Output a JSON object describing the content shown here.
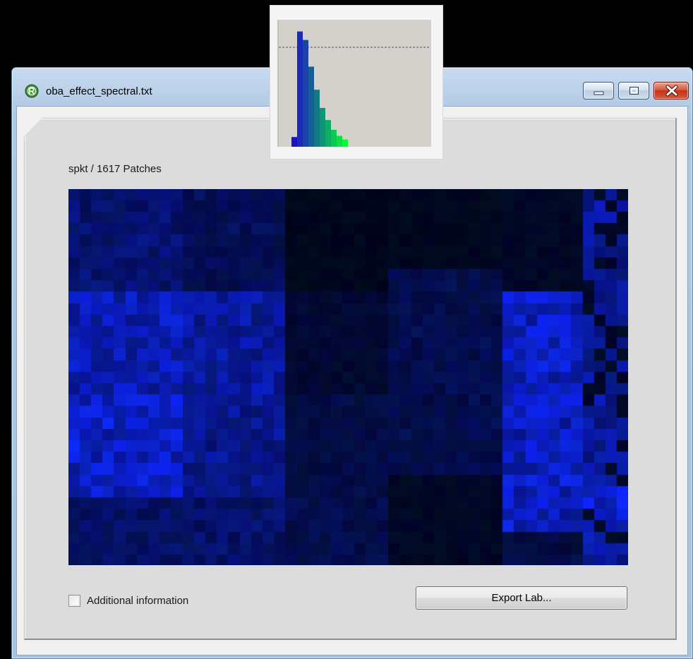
{
  "window": {
    "title": "oba_effect_spectral.txt",
    "controls": {
      "minimize": "minimize",
      "maximize": "maximize",
      "close": "close"
    }
  },
  "panel": {
    "heading": "spkt / 1617 Patches",
    "patch_count": 1617
  },
  "options": {
    "additional_info_label": "Additional information",
    "additional_info_checked": false
  },
  "actions": {
    "export_label": "Export Lab..."
  },
  "colors": {
    "heatmap_background": "#000000",
    "heatmap_dominant": "#0a1fd8",
    "histogram_low": "#1e10c8",
    "histogram_high": "#00ff30",
    "panel_background": "#dcdcdc",
    "close_button": "#c43417"
  },
  "chart_data": {
    "type": "bar",
    "title": "",
    "xlabel": "",
    "ylabel": "",
    "grid": false,
    "legend": "none",
    "reference_line": 0.82,
    "values": [
      0.08,
      0.95,
      0.88,
      0.66,
      0.47,
      0.32,
      0.22,
      0.14,
      0.09,
      0.06
    ],
    "ylim": [
      0,
      1
    ]
  }
}
